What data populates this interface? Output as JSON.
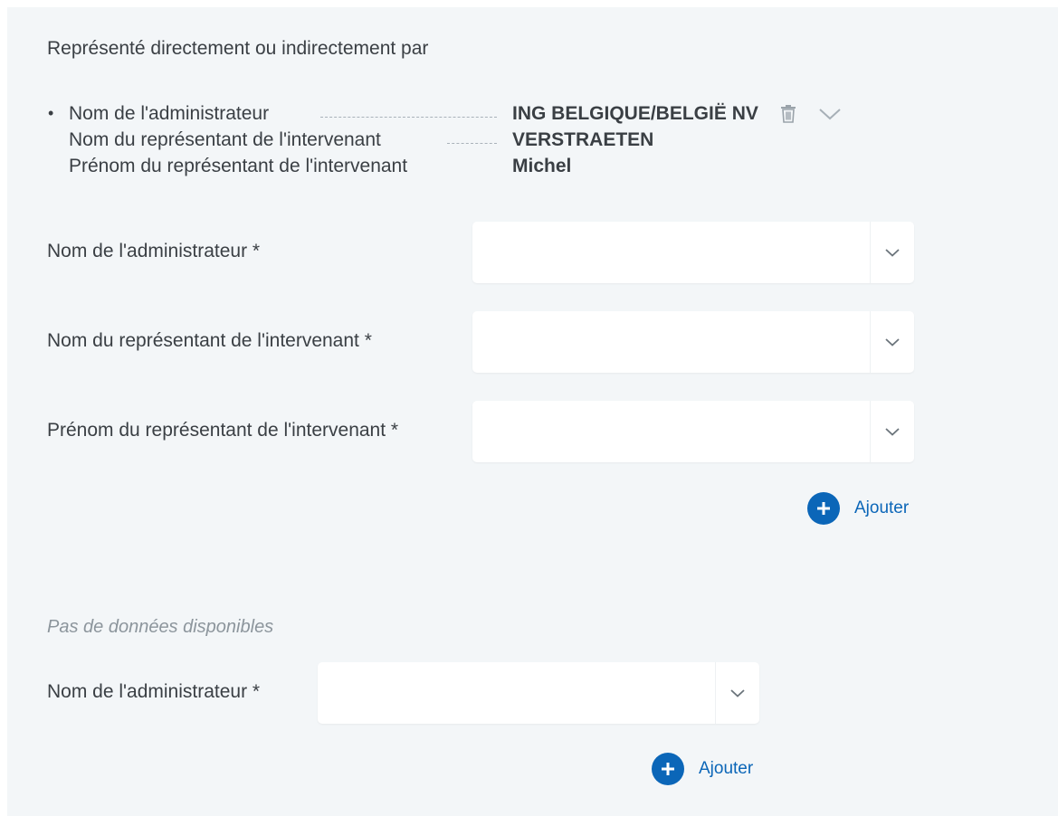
{
  "section": {
    "title": "Représenté directement ou indirectement par"
  },
  "summary": {
    "bullet": "•",
    "rows": [
      {
        "label": "Nom de l'administrateur",
        "value": "ING BELGIQUE/BELGIË NV"
      },
      {
        "label": "Nom du représentant de l'intervenant",
        "value": "VERSTRAETEN"
      },
      {
        "label": "Prénom du représentant de l'intervenant",
        "value": "Michel"
      }
    ],
    "actions": {
      "delete_icon": "trash-icon",
      "expand_icon": "chevron-down-icon"
    }
  },
  "form": {
    "fields": [
      {
        "label": "Nom de l'administrateur *",
        "value": ""
      },
      {
        "label": "Nom du représentant de l'intervenant *",
        "value": ""
      },
      {
        "label": "Prénom du représentant de l'intervenant *",
        "value": ""
      }
    ],
    "add_label": "Ajouter"
  },
  "second_form": {
    "empty_text": "Pas de données disponibles",
    "fields": [
      {
        "label": "Nom de l'administrateur *",
        "value": ""
      }
    ],
    "add_label": "Ajouter"
  },
  "colors": {
    "panel_bg": "#f3f6f8",
    "text": "#3a3f44",
    "accent": "#0b66b8",
    "muted": "#8c959c"
  }
}
